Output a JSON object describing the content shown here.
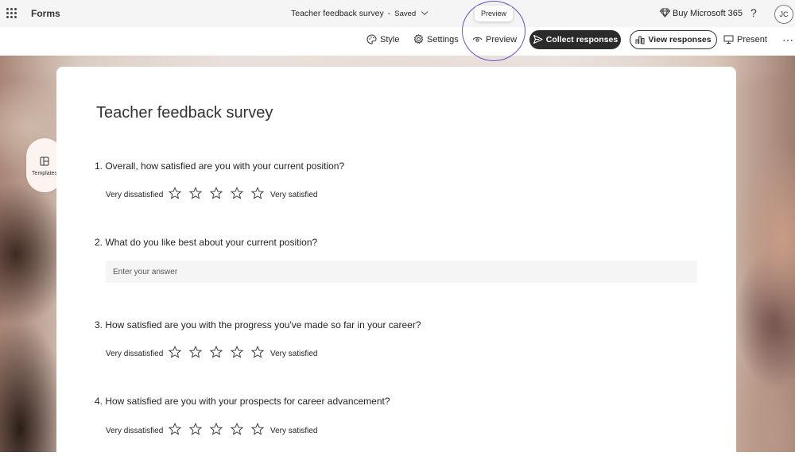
{
  "app": {
    "name": "Forms"
  },
  "document": {
    "title": "Teacher feedback survey",
    "separator": "-",
    "status": "Saved"
  },
  "header": {
    "buy_label": "Buy Microsoft 365",
    "help_label": "?",
    "avatar_initials": "JC"
  },
  "toolbar": {
    "style_label": "Style",
    "settings_label": "Settings",
    "preview_label": "Preview",
    "collect_label": "Collect responses",
    "view_label": "View responses",
    "present_label": "Present",
    "more_label": "⋯"
  },
  "tooltip": {
    "text": "Preview"
  },
  "highlight_color": "#6a4fc9",
  "sidebar": {
    "templates_label": "Templates"
  },
  "form": {
    "title": "Teacher feedback survey",
    "questions": [
      {
        "text": "1. Overall, how satisfied are you with your current position?",
        "type": "rating",
        "low_label": "Very dissatisfied",
        "high_label": "Very satisfied",
        "stars": 5
      },
      {
        "text": "2. What do you like best about your current position?",
        "type": "text",
        "placeholder": "Enter your answer"
      },
      {
        "text": "3. How satisfied are you with the progress you've made so far in your career?",
        "type": "rating",
        "low_label": "Very dissatisfied",
        "high_label": "Very satisfied",
        "stars": 5
      },
      {
        "text": "4. How satisfied are you with your prospects for career advancement?",
        "type": "rating",
        "low_label": "Very dissatisfied",
        "high_label": "Very satisfied",
        "stars": 5
      }
    ]
  }
}
